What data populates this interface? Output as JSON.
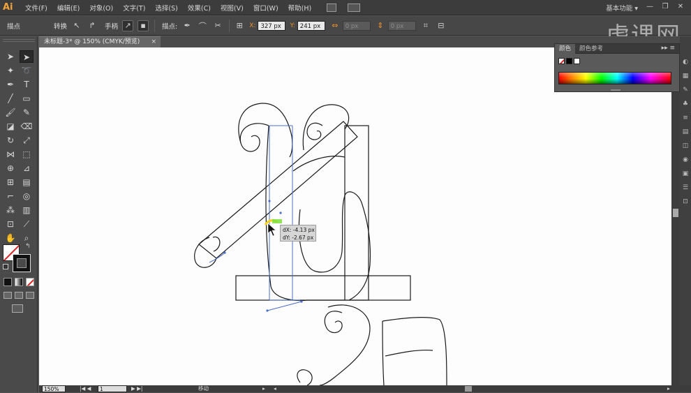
{
  "app": {
    "logo": "Ai"
  },
  "menus": [
    "文件(F)",
    "编辑(E)",
    "对象(O)",
    "文字(T)",
    "选择(S)",
    "效果(C)",
    "视图(V)",
    "窗口(W)",
    "帮助(H)"
  ],
  "workspace": {
    "label": "基本功能 ▾"
  },
  "window_controls": {
    "minimize": "—",
    "restore": "❐",
    "close": "✕"
  },
  "control_bar": {
    "anchor_label": "描点",
    "convert_label": "转换",
    "handle_label": "手柄",
    "anchor_point_label": "描点:",
    "x_label": "X:",
    "x_value": "327 px",
    "y_label": "Y:",
    "y_value": "241 px",
    "w_value": "0 px",
    "h_value": "0 px"
  },
  "watermark": {
    "text": "虎课网"
  },
  "document_tab": {
    "title": "未标题-3* @ 150% (CMYK/预览)",
    "close": "×"
  },
  "tooltip": {
    "dx": "dX: -4.13 px",
    "dy": "dY: -2.67 px"
  },
  "color_panel": {
    "tab_color": "颜色",
    "tab_guide": "颜色参考",
    "menu_icon": "▸▸ ≡",
    "swatches": [
      "none",
      "#000000",
      "#ffffff"
    ]
  },
  "status_bar": {
    "zoom": "150%",
    "artboard": "1",
    "tool_name": "移动"
  },
  "colors": {
    "accent_orange": "#f2a33a",
    "selection_blue": "#4a6ec9",
    "highlight_green": "#7cdf3c"
  },
  "tools": [
    "selection-icon",
    "direct-selection-icon",
    "magic-wand-icon",
    "lasso-icon",
    "pen-icon",
    "type-icon",
    "line-icon",
    "rectangle-icon",
    "paintbrush-icon",
    "pencil-icon",
    "blob-brush-icon",
    "eraser-icon",
    "rotate-icon",
    "scale-icon",
    "width-icon",
    "free-transform-icon",
    "shape-builder-icon",
    "perspective-icon",
    "mesh-icon",
    "gradient-icon",
    "eyedropper-icon",
    "blend-icon",
    "symbol-sprayer-icon",
    "column-graph-icon",
    "artboard-icon",
    "slice-icon",
    "hand-icon",
    "zoom-icon"
  ]
}
